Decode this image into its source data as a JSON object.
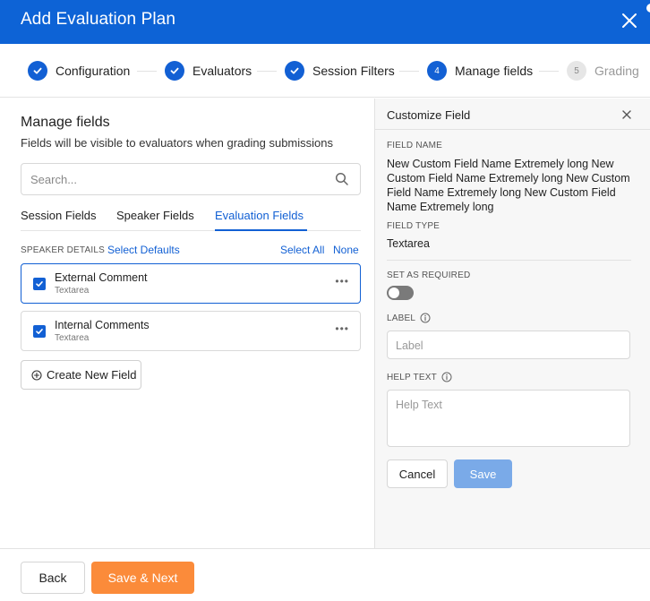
{
  "header": {
    "title": "Add Evaluation Plan"
  },
  "stepper": {
    "steps": [
      {
        "label": "Configuration",
        "state": "done"
      },
      {
        "label": "Evaluators",
        "state": "done"
      },
      {
        "label": "Session Filters",
        "state": "done"
      },
      {
        "label": "Manage fields",
        "state": "active",
        "number": "4"
      },
      {
        "label": "Grading",
        "state": "pending",
        "number": "5"
      }
    ]
  },
  "manage": {
    "title": "Manage fields",
    "subtitle": "Fields will be visible to evaluators when grading submissions",
    "search_placeholder": "Search...",
    "tabs": [
      "Session Fields",
      "Speaker Fields",
      "Evaluation Fields"
    ],
    "active_tab": "Evaluation Fields",
    "section_caption": "SPEAKER DETAILS",
    "select_defaults": "Select Defaults",
    "select_all": "Select All",
    "select_none": "None",
    "fields": [
      {
        "name": "External Comment",
        "type": "Textarea",
        "checked": true,
        "selected": true
      },
      {
        "name": "Internal Comments",
        "type": "Textarea",
        "checked": true,
        "selected": false
      }
    ],
    "create_label": "Create New Field"
  },
  "customize": {
    "title": "Customize Field",
    "field_name_caption": "FIELD NAME",
    "field_name_value": "New Custom Field Name Extremely long New Custom Field Name Extremely long New Custom Field Name Extremely long New Custom Field Name Extremely long",
    "field_type_caption": "FIELD TYPE",
    "field_type_value": "Textarea",
    "required_caption": "SET AS REQUIRED",
    "required": false,
    "label_caption": "LABEL",
    "label_placeholder": "Label",
    "help_caption": "HELP TEXT",
    "help_placeholder": "Help Text",
    "cancel_label": "Cancel",
    "save_label": "Save"
  },
  "footer": {
    "back_label": "Back",
    "next_label": "Save & Next"
  },
  "colors": {
    "brand": "#0d63d6",
    "accent": "#1260d4",
    "cta": "#fb8b3a",
    "save_disabled": "#7aaae8"
  }
}
